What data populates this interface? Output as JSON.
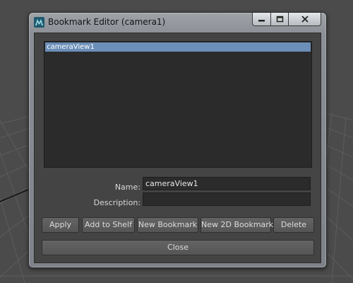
{
  "window": {
    "title": "Bookmark Editor (camera1)",
    "min_glyph": "—",
    "close_glyph": "✕"
  },
  "bookmarks": {
    "items": [
      "cameraView1"
    ],
    "selected_index": 0
  },
  "form": {
    "name_label": "Name:",
    "name_value": "cameraView1",
    "description_label": "Description:",
    "description_value": ""
  },
  "buttons": {
    "apply": "Apply",
    "add_to_shelf": "Add to Shelf",
    "new_bookmark": "New Bookmark",
    "new_2d_bookmark": "New 2D Bookmark",
    "delete": "Delete",
    "close": "Close"
  },
  "colors": {
    "selection": "#6b8fb8",
    "panel": "#444444",
    "field": "#2b2b2b",
    "viewport": "#4b4b4b"
  },
  "icons": {
    "app": "maya-icon",
    "minimize": "minimize-icon",
    "maximize": "maximize-icon",
    "close": "close-icon"
  }
}
